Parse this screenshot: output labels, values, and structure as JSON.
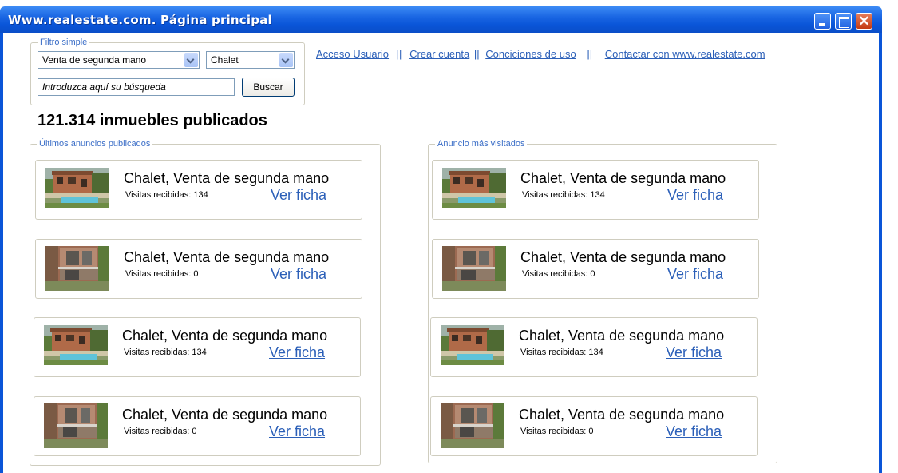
{
  "window": {
    "title": "Www.realestate.com. Página principal",
    "accent": "#0a55d8"
  },
  "filter": {
    "legend": "Filtro simple",
    "type_select": "Venta de segunda mano",
    "kind_select": "Chalet",
    "search_placeholder": "Introduzca aquí su búsqueda",
    "search_button": "Buscar"
  },
  "nav": {
    "links": [
      "Acceso Usuario",
      "Crear cuenta",
      "Conciciones de uso",
      "Contactar con www.realestate.com"
    ],
    "separators": [
      "||",
      "||",
      "||"
    ]
  },
  "summary": {
    "count_text": "121.314 inmuebles publicados"
  },
  "latest": {
    "legend": "Últimos anuncios publicados",
    "items": [
      {
        "title": "Chalet, Venta de segunda mano",
        "visits_label": "Visitas recibidas: 134",
        "link": "Ver ficha",
        "photo": "house-pool"
      },
      {
        "title": "Chalet, Venta de segunda mano",
        "visits_label": "Visitas recibidas: 0",
        "link": "Ver ficha",
        "photo": "house-balcony"
      },
      {
        "title": "Chalet, Venta de segunda mano",
        "visits_label": "Visitas recibidas: 134",
        "link": "Ver ficha",
        "photo": "house-pool"
      },
      {
        "title": "Chalet, Venta de segunda mano",
        "visits_label": "Visitas recibidas: 0",
        "link": "Ver ficha",
        "photo": "house-balcony"
      }
    ]
  },
  "popular": {
    "legend": "Anuncio más visitados",
    "items": [
      {
        "title": "Chalet, Venta de segunda mano",
        "visits_label": "Visitas recibidas: 134",
        "link": "Ver ficha",
        "photo": "house-pool"
      },
      {
        "title": "Chalet, Venta de segunda mano",
        "visits_label": "Visitas recibidas: 0",
        "link": "Ver ficha",
        "photo": "house-balcony"
      },
      {
        "title": "Chalet, Venta de segunda mano",
        "visits_label": "Visitas recibidas: 134",
        "link": "Ver ficha",
        "photo": "house-pool"
      },
      {
        "title": "Chalet, Venta de segunda mano",
        "visits_label": "Visitas recibidas: 0",
        "link": "Ver ficha",
        "photo": "house-balcony"
      }
    ]
  }
}
